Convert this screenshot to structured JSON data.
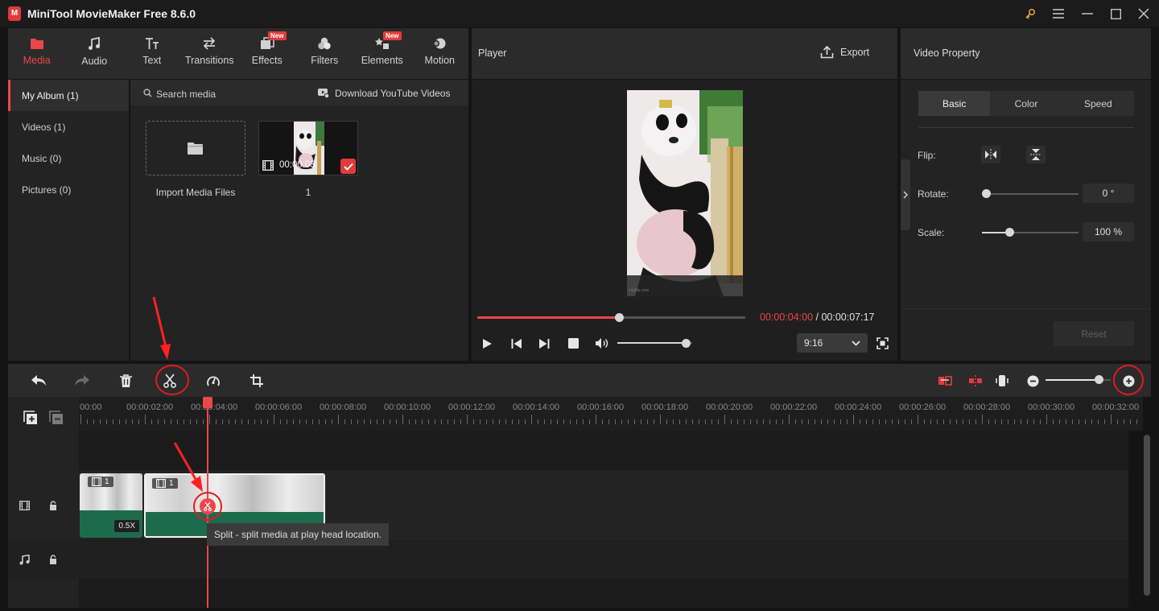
{
  "app": {
    "title": "MiniTool MovieMaker Free 8.6.0",
    "logo_letter": "M"
  },
  "media_tabs": [
    {
      "label": "Media",
      "icon": "folder-icon",
      "active": true
    },
    {
      "label": "Audio",
      "icon": "music-note-icon"
    },
    {
      "label": "Text",
      "icon": "text-icon"
    },
    {
      "label": "Transitions",
      "icon": "transitions-icon"
    },
    {
      "label": "Effects",
      "icon": "effects-icon",
      "badge": "New"
    },
    {
      "label": "Filters",
      "icon": "filters-icon"
    },
    {
      "label": "Elements",
      "icon": "elements-icon",
      "badge": "New"
    },
    {
      "label": "Motion",
      "icon": "motion-icon"
    }
  ],
  "album": [
    {
      "label": "My Album (1)",
      "active": true
    },
    {
      "label": "Videos (1)"
    },
    {
      "label": "Music (0)"
    },
    {
      "label": "Pictures (0)"
    }
  ],
  "library": {
    "search_placeholder": "Search media",
    "download_label": "Download YouTube Videos",
    "import_label": "Import Media Files",
    "clip_duration": "00:00:03",
    "clip_name": "1"
  },
  "player": {
    "title": "Player",
    "export_label": "Export",
    "current_time": "00:00:04:00",
    "separator": " / ",
    "total_time": "00:00:07:17",
    "progress": 0.53,
    "volume": 0.91,
    "aspect": "9:16",
    "watermark": "imgflip.com"
  },
  "property": {
    "title": "Video Property",
    "tabs": [
      "Basic",
      "Color",
      "Speed"
    ],
    "flip_label": "Flip:",
    "rotate_label": "Rotate:",
    "rotate_value": "0 °",
    "rotate_level": 0.0,
    "scale_label": "Scale:",
    "scale_value": "100 %",
    "scale_level": 0.28,
    "reset_label": "Reset"
  },
  "timeline": {
    "ticks": [
      "00:00",
      "00:00:02:00",
      "00:00:04:00",
      "00:00:06:00",
      "00:00:08:00",
      "00:00:10:00",
      "00:00:12:00",
      "00:00:14:00",
      "00:00:16:00",
      "00:00:18:00",
      "00:00:20:00",
      "00:00:22:00",
      "00:00:24:00",
      "00:00:26:00",
      "00:00:28:00",
      "00:00:30:00",
      "00:00:32:00"
    ],
    "clip1": {
      "label": "1",
      "speed": "0.5X"
    },
    "clip2": {
      "label": "1"
    },
    "zoom_level": 0.82,
    "tooltip": "Split - split media at play head location."
  },
  "colors": {
    "accent": "#e9474a",
    "highlight": "#e21b1b",
    "clip": "#1d6b4f"
  }
}
